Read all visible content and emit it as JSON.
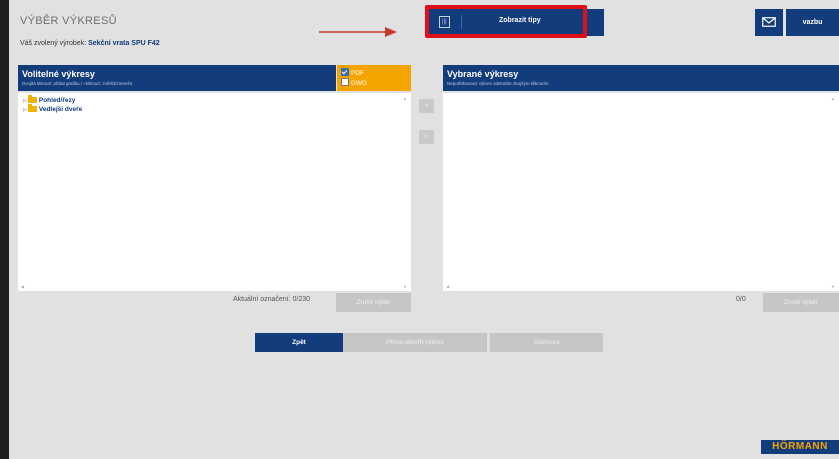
{
  "header": {
    "title": "VÝBĚR VÝKRESŮ",
    "product_label": "Váš zvolený výrobek:",
    "product_value": "Sekční vrata SPU F42"
  },
  "toolbar": {
    "tips_icon_text": "|||",
    "tips_label": "Zobrazit tipy",
    "feedback_label": "vazbu"
  },
  "available": {
    "title": "Volitelné výkresy",
    "hint": "Dvojitá kliknutí: přidat grafiku / +kliknutí: zvětšit/zmenšit",
    "items": [
      {
        "label": "Pohled/řezy"
      },
      {
        "label": "Vedlejší dveře"
      }
    ],
    "counter": "Aktuální označení: 0/230",
    "clear_label": "Zrušit výběr"
  },
  "formats": {
    "pdf": {
      "label": "PDF",
      "checked": true
    },
    "dwg": {
      "label": "DWG",
      "checked": false
    }
  },
  "transfer": {
    "add_label": "»",
    "remove_label": "«"
  },
  "selected": {
    "title": "Vybrané výkresy",
    "hint": "Nepotřebovaný výkres odstraňte dvojitým kliknutím",
    "counter": "0/0",
    "clear_label": "Zrušit výběr"
  },
  "footer": {
    "back_label": "Zpět",
    "open_label": "Přímo otevřít výkres",
    "download_label": "Stáhnout"
  },
  "brand": {
    "logo_text": "HÖRMANN"
  },
  "colors": {
    "primary": "#123c7b",
    "accent": "#f5a400",
    "highlight": "#e0101a"
  }
}
